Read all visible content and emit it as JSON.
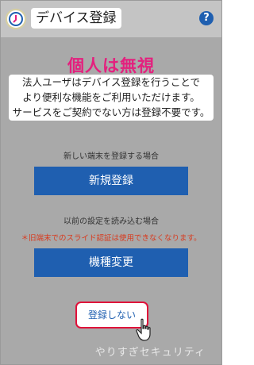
{
  "header": {
    "title": "デバイス登録",
    "help_label": "?"
  },
  "overlay_title": "個人は無視",
  "notice_lines": [
    "法人ユーザはデバイス登録を行うことで",
    "より便利な機能をご利用いただけます。",
    "サービスをご契約でない方は登録不要です。"
  ],
  "new_device": {
    "label": "新しい端末を登録する場合",
    "button": "新規登録"
  },
  "restore": {
    "label": "以前の設定を読み込む場合",
    "warning": "＊旧端末でのスライド認証は使用できなくなります。",
    "button": "機種変更"
  },
  "skip_button": "登録しない",
  "watermark": "やりすぎセキュリティ",
  "colors": {
    "primary": "#1f5fb0",
    "highlight": "#e4207e",
    "warning": "#d83a1e",
    "skip_border": "#e0103a"
  },
  "icons": {
    "app": "app-logo-icon",
    "help": "help-icon",
    "cursor": "hand-pointer-icon"
  }
}
